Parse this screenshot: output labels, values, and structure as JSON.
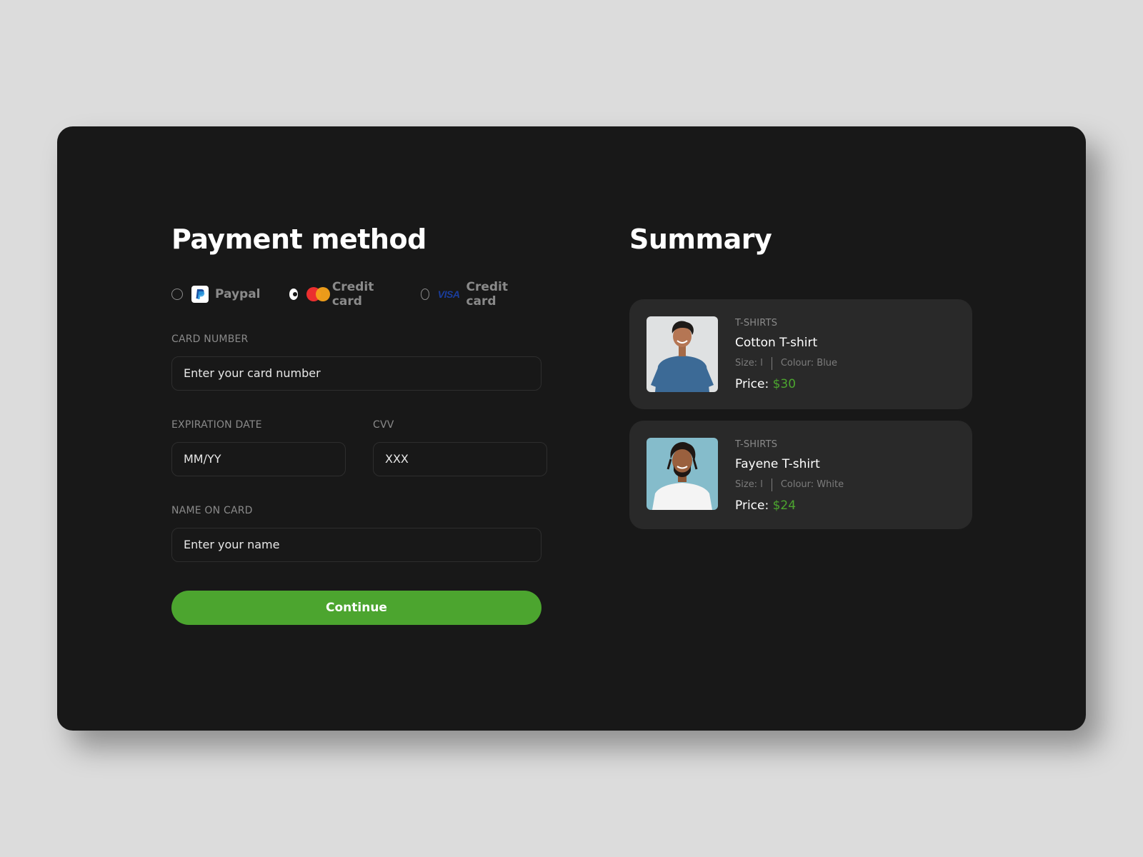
{
  "payment": {
    "title": "Payment method",
    "methods": [
      {
        "label": "Paypal",
        "icon": "paypal-icon",
        "selected": false
      },
      {
        "label": "Credit card",
        "icon": "mastercard-icon",
        "selected": true
      },
      {
        "label": "Credit card",
        "icon": "visa-icon",
        "selected": false
      }
    ],
    "visa_text": "VISA",
    "card_number": {
      "label": "CARD NUMBER",
      "placeholder": "Enter your card number"
    },
    "expiration": {
      "label": "EXPIRATION DATE",
      "placeholder": "MM/YY"
    },
    "cvv": {
      "label": "CVV",
      "placeholder": "XXX"
    },
    "name": {
      "label": "NAME ON CARD",
      "placeholder": "Enter your name"
    },
    "continue_label": "Continue"
  },
  "summary": {
    "title": "Summary",
    "items": [
      {
        "category": "T-SHIRTS",
        "name": "Cotton T-shirt",
        "size": "Size: l",
        "colour": "Colour: Blue",
        "price_label": "Price:",
        "price": "$30"
      },
      {
        "category": "T-SHIRTS",
        "name": "Fayene T-shirt",
        "size": "Size: l",
        "colour": "Colour: White",
        "price_label": "Price:",
        "price": "$24"
      }
    ]
  },
  "colors": {
    "background": "#dcdcdc",
    "card": "#181818",
    "item": "#292929",
    "accent": "#4ca52f",
    "muted": "#8a8a8a"
  }
}
